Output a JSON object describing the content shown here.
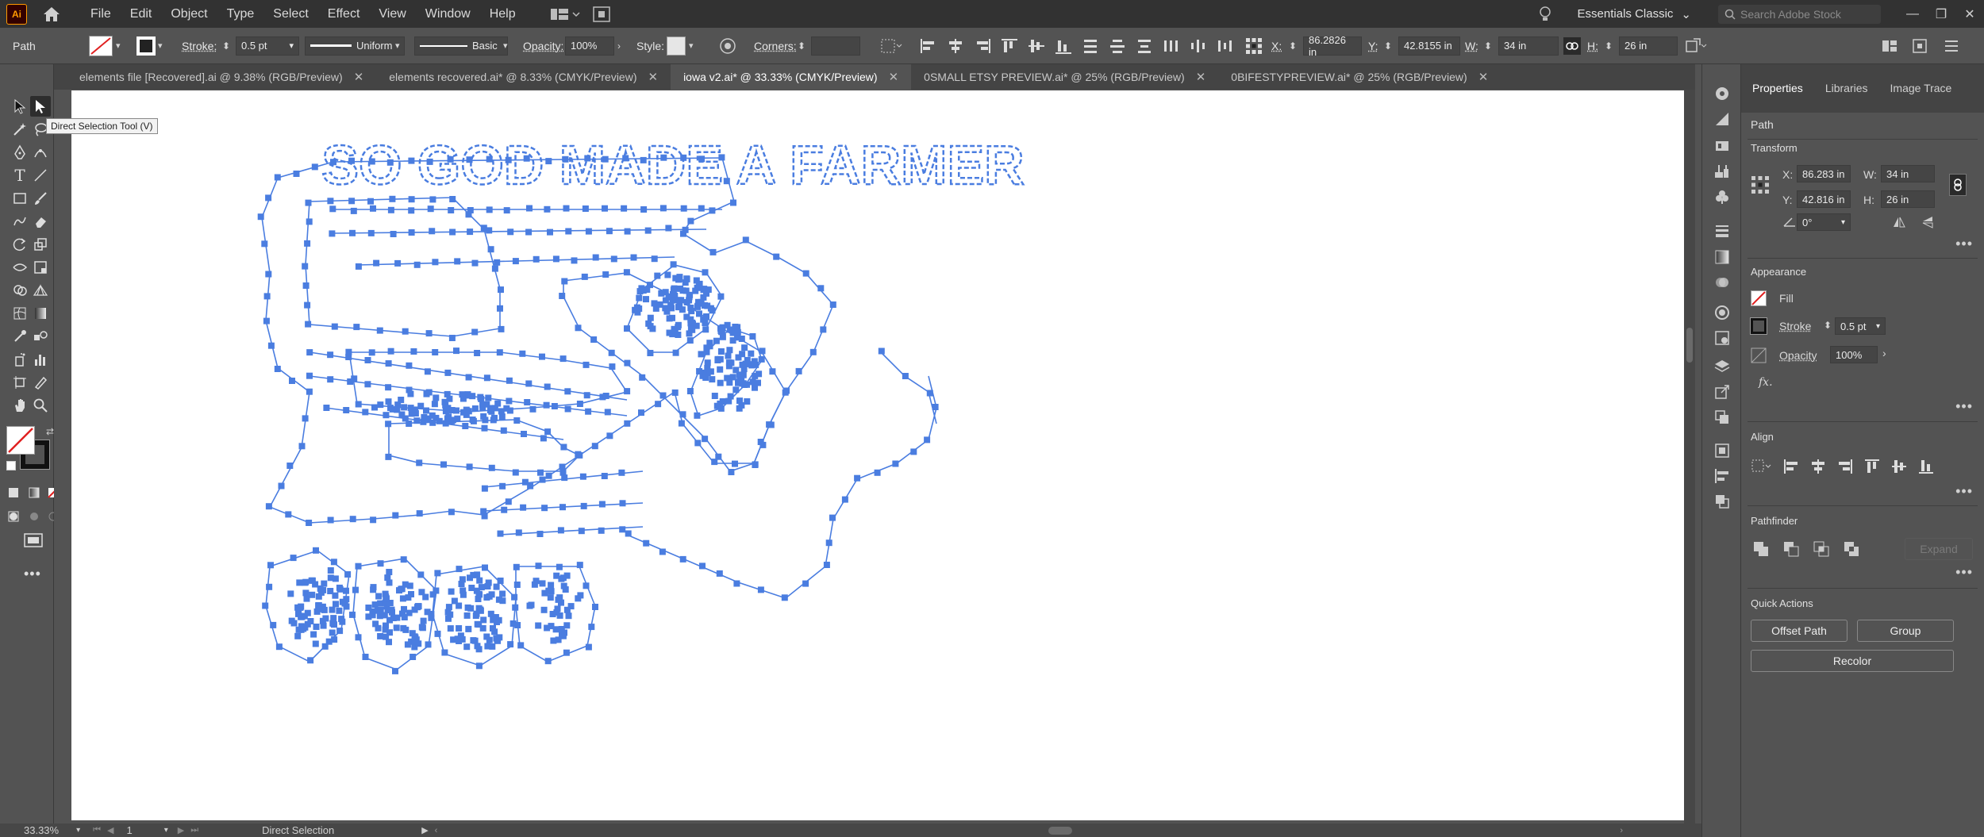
{
  "app": {
    "logo": "Ai"
  },
  "menu": [
    "File",
    "Edit",
    "Object",
    "Type",
    "Select",
    "Effect",
    "View",
    "Window",
    "Help"
  ],
  "workspace": "Essentials Classic",
  "stock_search": {
    "placeholder": "Search Adobe Stock"
  },
  "control": {
    "selection_type": "Path",
    "stroke_label": "Stroke:",
    "stroke_weight": "0.5 pt",
    "profile_uniform": "Uniform",
    "brush_basic": "Basic",
    "opacity_label": "Opacity:",
    "opacity_value": "100%",
    "style_label": "Style:",
    "corners_label": "Corners:",
    "x_label": "X:",
    "x_value": "86.2826 in",
    "y_label": "Y:",
    "y_value": "42.8155 in",
    "w_label": "W:",
    "w_value": "34 in",
    "h_label": "H:",
    "h_value": "26 in"
  },
  "tabs": [
    {
      "label": "elements file [Recovered].ai @ 9.38% (RGB/Preview)"
    },
    {
      "label": "elements recovered.ai* @ 8.33% (CMYK/Preview)"
    },
    {
      "label": "iowa v2.ai* @ 33.33% (CMYK/Preview)",
      "active": true
    },
    {
      "label": "0SMALL ETSY PREVIEW.ai* @ 25% (RGB/Preview)"
    },
    {
      "label": "0BIFESTYPREVIEW.ai* @ 25% (RGB/Preview)"
    }
  ],
  "tooltip": "Direct Selection Tool (V)",
  "artwork": {
    "headline": "SO GOD MADE A FARMER",
    "path_color": "#4a7de0"
  },
  "status": {
    "zoom": "33.33%",
    "artboard_num": "1",
    "tool_name": "Direct Selection"
  },
  "panel": {
    "tabs": [
      "Properties",
      "Libraries",
      "Image Trace"
    ],
    "selection_type": "Path",
    "transform_title": "Transform",
    "x_label": "X:",
    "x_value": "86.283 in",
    "y_label": "Y:",
    "y_value": "42.816 in",
    "w_label": "W:",
    "w_value": "34 in",
    "h_label": "H:",
    "h_value": "26 in",
    "angle_value": "0°",
    "appearance_title": "Appearance",
    "fill_label": "Fill",
    "stroke_label": "Stroke",
    "stroke_value": "0.5 pt",
    "opacity_label": "Opacity",
    "opacity_value": "100%",
    "fx_label": "fx.",
    "align_title": "Align",
    "pathfinder_title": "Pathfinder",
    "expand_label": "Expand",
    "quick_actions_title": "Quick Actions",
    "offset_path": "Offset Path",
    "group": "Group",
    "recolor": "Recolor"
  }
}
